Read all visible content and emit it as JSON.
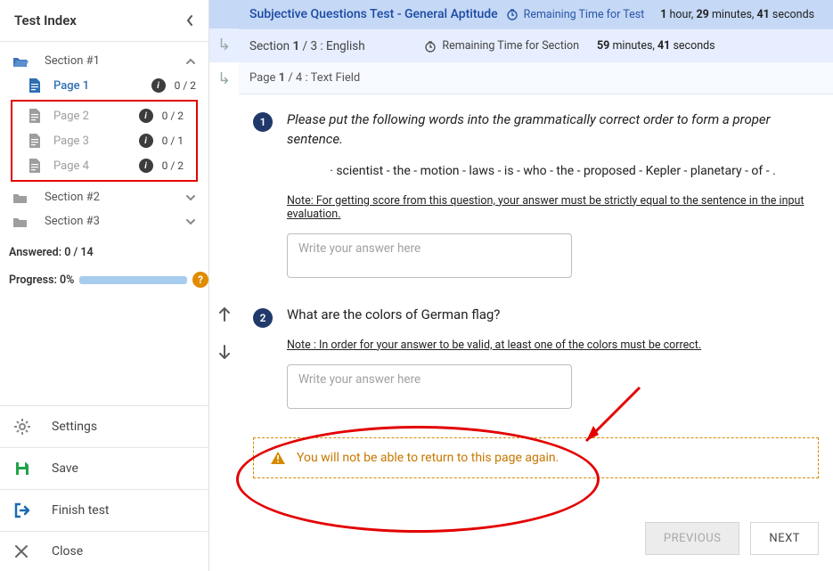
{
  "sidebar": {
    "title": "Test Index",
    "sections": [
      {
        "label": "Section #1",
        "open": true
      },
      {
        "label": "Section #2",
        "open": false
      },
      {
        "label": "Section #3",
        "open": false
      }
    ],
    "pages": [
      {
        "label": "Page 1",
        "count": "0 / 2",
        "active": true
      },
      {
        "label": "Page 2",
        "count": "0 / 2",
        "active": false
      },
      {
        "label": "Page 3",
        "count": "0 / 1",
        "active": false
      },
      {
        "label": "Page 4",
        "count": "0 / 2",
        "active": false
      }
    ],
    "answered_label": "Answered: 0 / 14",
    "progress_label": "Progress: 0%",
    "actions": {
      "settings": "Settings",
      "save": "Save",
      "finish": "Finish test",
      "close": "Close"
    }
  },
  "topbar": {
    "title": "Subjective Questions Test - General Aptitude",
    "timer_label": "Remaining Time for Test",
    "hour_n": "1",
    "hour_u": " hour, ",
    "min_n": "29",
    "min_u": " minutes, ",
    "sec_n": "41",
    "sec_u": " seconds"
  },
  "sectionbar": {
    "prefix": "Section  ",
    "num": "1",
    "sep": " / 3 : ",
    "name": "English",
    "timer_label": "Remaining Time for Section",
    "min_n": "59",
    "min_u": " minutes, ",
    "sec_n": "41",
    "sec_u": " seconds"
  },
  "pagebar": {
    "prefix": "Page  ",
    "num": "1",
    "sep": " / 4 : ",
    "name": "Text Field"
  },
  "questions": [
    {
      "num": "1",
      "text": "Please put the following words into the grammatically correct order to form a proper sentence.",
      "words": "· scientist - the - motion - laws - is - who - the - proposed - Kepler - planetary - of - .",
      "note": "Note: For getting score from this question, your answer must be strictly equal to the sentence in the input evaluation.",
      "placeholder": "Write your answer here"
    },
    {
      "num": "2",
      "text": "What are the colors of German flag?",
      "note": "Note : In order for your answer to be valid, at least one of the colors must be correct.",
      "placeholder": "Write your answer here"
    }
  ],
  "warning": "You will not be able to return to this page again.",
  "footer": {
    "prev": "PREVIOUS",
    "next": "NEXT"
  }
}
